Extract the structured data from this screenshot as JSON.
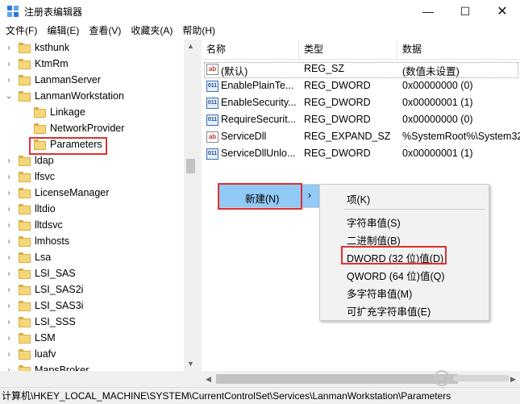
{
  "window": {
    "title": "注册表编辑器",
    "min_glyph": "—",
    "max_glyph": "☐",
    "close_glyph": "✕"
  },
  "menu": [
    "文件(F)",
    "编辑(E)",
    "查看(V)",
    "收藏夹(A)",
    "帮助(H)"
  ],
  "tree": {
    "items": [
      {
        "label": "ksthunk",
        "expander": "›"
      },
      {
        "label": "KtmRm",
        "expander": "›"
      },
      {
        "label": "LanmanServer",
        "expander": "›"
      },
      {
        "label": "LanmanWorkstation",
        "expander": "⌄"
      },
      {
        "label": "Linkage",
        "expander": ""
      },
      {
        "label": "NetworkProvider",
        "expander": ""
      },
      {
        "label": "Parameters",
        "expander": ""
      },
      {
        "label": "ldap",
        "expander": "›"
      },
      {
        "label": "lfsvc",
        "expander": "›"
      },
      {
        "label": "LicenseManager",
        "expander": "›"
      },
      {
        "label": "lltdio",
        "expander": "›"
      },
      {
        "label": "lltdsvc",
        "expander": "›"
      },
      {
        "label": "lmhosts",
        "expander": "›"
      },
      {
        "label": "Lsa",
        "expander": "›"
      },
      {
        "label": "LSI_SAS",
        "expander": "›"
      },
      {
        "label": "LSI_SAS2i",
        "expander": "›"
      },
      {
        "label": "LSI_SAS3i",
        "expander": "›"
      },
      {
        "label": "LSI_SSS",
        "expander": "›"
      },
      {
        "label": "LSM",
        "expander": "›"
      },
      {
        "label": "luafv",
        "expander": "›"
      },
      {
        "label": "MapsBroker",
        "expander": "›"
      }
    ]
  },
  "list": {
    "columns": [
      "名称",
      "类型",
      "数据"
    ],
    "rows": [
      {
        "icon": "ab",
        "name": "(默认)",
        "type": "REG_SZ",
        "data": "(数值未设置)"
      },
      {
        "icon": "dw",
        "name": "EnablePlainTe...",
        "type": "REG_DWORD",
        "data": "0x00000000 (0)"
      },
      {
        "icon": "dw",
        "name": "EnableSecurity...",
        "type": "REG_DWORD",
        "data": "0x00000001 (1)"
      },
      {
        "icon": "dw",
        "name": "RequireSecurit...",
        "type": "REG_DWORD",
        "data": "0x00000000 (0)"
      },
      {
        "icon": "ab",
        "name": "ServiceDll",
        "type": "REG_EXPAND_SZ",
        "data": "%SystemRoot%\\System32"
      },
      {
        "icon": "dw",
        "name": "ServiceDllUnlo...",
        "type": "REG_DWORD",
        "data": "0x00000001 (1)"
      }
    ]
  },
  "context_menu": {
    "new_label": "新建(N)",
    "submenu_arrow": "›",
    "submenu": [
      "项(K)",
      "字符串值(S)",
      "二进制值(B)",
      "DWORD (32 位)值(D)",
      "QWORD (64 位)值(Q)",
      "多字符串值(M)",
      "可扩充字符串值(E)"
    ]
  },
  "status": {
    "path": "计算机\\HKEY_LOCAL_MACHINE\\SYSTEM\\CurrentControlSet\\Services\\LanmanWorkstation\\Parameters"
  },
  "colors": {
    "accent_highlight": "#91c9f7",
    "annotation_red": "#e03030",
    "folder": "#f5d67a"
  }
}
